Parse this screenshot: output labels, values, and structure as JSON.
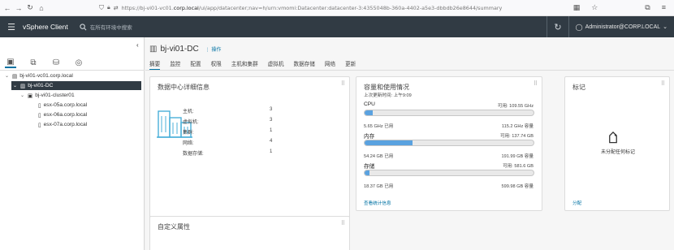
{
  "browser": {
    "url_prefix": "https://bj-vi01-vc01.",
    "url_domain": "corp.local",
    "url_rest": "/ui/app/datacenter;nav=h/urn:vmomi:Datacenter:datacenter-3:4355048b-360a-4402-a5e3-dbbdb26e8644/summary"
  },
  "header": {
    "app_title": "vSphere Client",
    "search_placeholder": "在所有环境中搜索",
    "user": "Administrator@CORP.LOCAL"
  },
  "tree": [
    {
      "label": "bj-vi01-vc01.corp.local",
      "icon": "vcenter-icon"
    },
    {
      "label": "bj-vi01-DC",
      "icon": "datacenter-icon"
    },
    {
      "label": "bj-vi01-cluster01",
      "icon": "cluster-icon"
    },
    {
      "label": "esx-05a.corp.local",
      "icon": "host-icon"
    },
    {
      "label": "esx-06a.corp.local",
      "icon": "host-icon"
    },
    {
      "label": "esx-07a.corp.local",
      "icon": "host-icon"
    }
  ],
  "object": {
    "name": "bj-vi01-DC",
    "actions_label": "操作"
  },
  "tabs": [
    "摘要",
    "监控",
    "配置",
    "权限",
    "主机和集群",
    "虚拟机",
    "数据存储",
    "网络",
    "更新"
  ],
  "details": {
    "title": "数据中心详细信息",
    "rows": [
      {
        "label": "主机:",
        "value": "3"
      },
      {
        "label": "虚拟机:",
        "value": "3"
      },
      {
        "label": "集群:",
        "value": "1"
      },
      {
        "label": "网络:",
        "value": "4"
      },
      {
        "label": "数据存储:",
        "value": "1"
      }
    ]
  },
  "capacity": {
    "title": "容量和使用情况",
    "updated": "上次更新时间: 上午9:09",
    "cpu": {
      "label": "CPU",
      "free": "可用: 109.55 GHz",
      "used": "5.65 GHz 已用",
      "capacity": "115.2 GHz 容量",
      "fraction": 0.049
    },
    "memory": {
      "label": "内存",
      "free": "可用: 137.74 GB",
      "used": "54.24 GB 已用",
      "capacity": "191.99 GB 容量",
      "fraction": 0.283
    },
    "storage": {
      "label": "存储",
      "free": "可用: 581.6 GB",
      "used": "18.37 GB 已用",
      "capacity": "599.98 GB 容量",
      "fraction": 0.031
    },
    "link": "查看统计信息"
  },
  "tags": {
    "title": "标记",
    "empty": "未分配任何标记",
    "assign": "分配"
  },
  "custom": {
    "title": "自定义属性"
  },
  "colors": {
    "header_bg": "#313b44",
    "accent": "#0072a3",
    "bar_fill": "#5aa2e0"
  }
}
